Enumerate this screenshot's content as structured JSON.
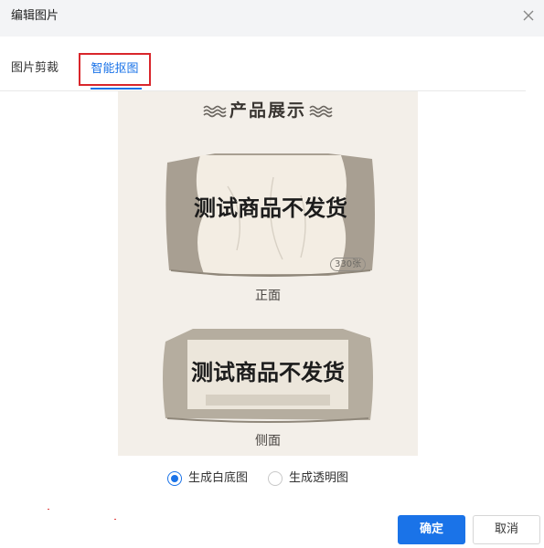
{
  "dialog": {
    "title": "编辑图片",
    "close_icon": "close-icon"
  },
  "tabs": [
    {
      "label": "图片剪裁",
      "active": false
    },
    {
      "label": "智能抠图",
      "active": true
    }
  ],
  "preview": {
    "heading": "产品展示",
    "heading_decor_icon": "wave-icon",
    "front": {
      "overlay_text": "测试商品不发货",
      "count_badge": "330张",
      "caption": "正面"
    },
    "side": {
      "overlay_text": "测试商品不发货",
      "caption": "侧面"
    }
  },
  "options": {
    "selected": "生成白底图",
    "items": [
      {
        "label": "生成白底图",
        "checked": true
      },
      {
        "label": "生成透明图",
        "checked": false
      }
    ]
  },
  "buttons": {
    "confirm": "确定",
    "cancel": "取消"
  },
  "colors": {
    "accent": "#1a73e8",
    "highlight_border": "#d9262b",
    "preview_bg": "#f3efe9",
    "pack_gray": "#a89f92"
  }
}
